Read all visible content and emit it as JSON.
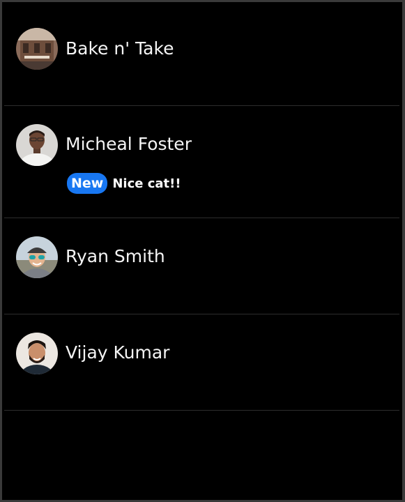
{
  "conversations": [
    {
      "name": "Bake n' Take",
      "avatar": "bakery-storefront-photo",
      "badge": "",
      "preview": ""
    },
    {
      "name": "Micheal Foster",
      "avatar": "man-white-shirt-photo",
      "badge": "New",
      "preview": "Nice cat!!"
    },
    {
      "name": "Ryan Smith",
      "avatar": "man-sunglasses-cap-photo",
      "badge": "",
      "preview": ""
    },
    {
      "name": "Vijay Kumar",
      "avatar": "man-beard-smiling-photo",
      "badge": "",
      "preview": ""
    }
  ],
  "colors": {
    "background": "#000000",
    "badge": "#1877f2",
    "divider": "#2d2d2d"
  }
}
